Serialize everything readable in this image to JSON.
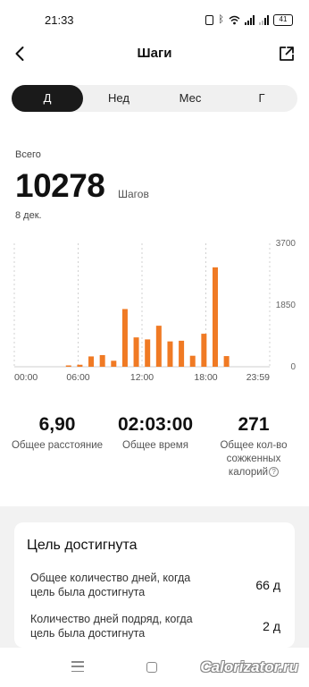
{
  "status_bar": {
    "time": "21:33",
    "battery": "41"
  },
  "header": {
    "title": "Шаги"
  },
  "tabs": [
    {
      "label": "Д",
      "active": true
    },
    {
      "label": "Нед",
      "active": false
    },
    {
      "label": "Мес",
      "active": false
    },
    {
      "label": "Г",
      "active": false
    }
  ],
  "summary": {
    "total_label": "Всего",
    "total_value": "10278",
    "total_unit": "Шагов",
    "date": "8 дек."
  },
  "chart_data": {
    "type": "bar",
    "title": "",
    "xlabel": "",
    "ylabel": "",
    "x_tick_labels": [
      "00:00",
      "06:00",
      "12:00",
      "18:00",
      "23:59"
    ],
    "y_tick_labels": [
      "3700",
      "1850",
      "0"
    ],
    "ylim": [
      0,
      3700
    ],
    "x_range_hours": [
      0,
      24
    ],
    "grid": "vertical dashed",
    "color": "#f07a24",
    "x": [
      6,
      7,
      8,
      9,
      10,
      11,
      12,
      13,
      14,
      15,
      16,
      17,
      18,
      19
    ],
    "values": [
      40,
      60,
      310,
      350,
      180,
      1730,
      880,
      820,
      1230,
      760,
      780,
      330,
      990,
      2980,
      320
    ]
  },
  "stats": [
    {
      "value": "6,90",
      "label": "Общее расстояние"
    },
    {
      "value": "02:03:00",
      "label": "Общее время"
    },
    {
      "value": "271",
      "label_line1": "Общее кол-во",
      "label_line2": "сожженных",
      "label_line3": "калорий"
    }
  ],
  "goal": {
    "title": "Цель достигнута",
    "rows": [
      {
        "label": "Общее количество дней, когда цель была достигнута",
        "value": "66 д"
      },
      {
        "label": "Количество дней подряд, когда цель была достигнута",
        "value": "2 д"
      }
    ]
  },
  "watermark": "Calorizator.ru",
  "colors": {
    "accent": "#f07a24",
    "tab_active_bg": "#1a1a1a",
    "tab_bg": "#f0f0f0",
    "section_bg": "#f2f2f2"
  }
}
